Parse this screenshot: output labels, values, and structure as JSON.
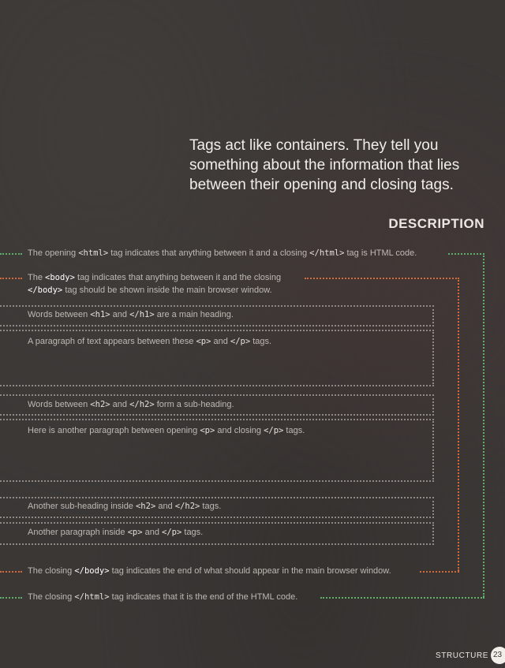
{
  "intro_text": "Tags act like containers. They tell you something about the information that lies between their opening and closing tags.",
  "section_heading": "DESCRIPTION",
  "lines": [
    {
      "parts": [
        "The opening ",
        "<html>",
        " tag indicates that anything between it and a closing ",
        "</html>",
        " tag is HTML code."
      ]
    },
    {
      "parts": [
        "The ",
        "<body>",
        " tag indicates that anything between it and the closing ",
        "</body>",
        " tag should be shown inside the main browser window."
      ]
    },
    {
      "parts": [
        "Words between ",
        "<h1>",
        " and ",
        "</h1>",
        " are a main heading."
      ]
    },
    {
      "parts": [
        "A paragraph of text appears between these ",
        "<p>",
        " and ",
        "</p>",
        " tags."
      ]
    },
    {
      "parts": [
        "Words between ",
        "<h2>",
        " and ",
        "</h2>",
        " form a sub-heading."
      ]
    },
    {
      "parts": [
        "Here is another paragraph between opening ",
        "<p>",
        " and closing ",
        "</p>",
        " tags."
      ]
    },
    {
      "parts": [
        "Another sub-heading inside ",
        "<h2>",
        " and ",
        "</h2>",
        " tags."
      ]
    },
    {
      "parts": [
        "Another paragraph inside ",
        "<p>",
        " and ",
        "</p>",
        " tags."
      ]
    },
    {
      "parts": [
        "The closing ",
        "</body>",
        " tag indicates the end of what should appear in the main browser window."
      ]
    },
    {
      "parts": [
        "The closing ",
        "</html>",
        " tag indicates that it is the end of the HTML code."
      ]
    }
  ],
  "footer": {
    "section_label": "STRUCTURE",
    "page_number": "23"
  },
  "colors": {
    "html_leader": "#5fae6a",
    "body_leader": "#d36a3d",
    "box_border": "#8f8985",
    "background": "#3a3735"
  }
}
